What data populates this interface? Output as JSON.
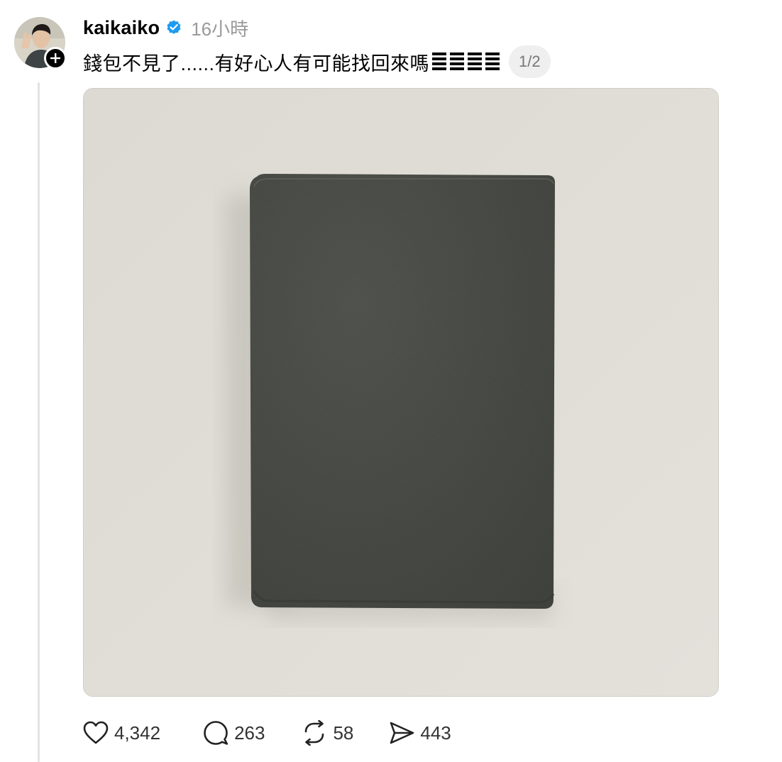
{
  "post": {
    "author": {
      "username": "kaikaiko",
      "verified": true,
      "avatar_icon": "avatar-photo",
      "follow_icon": "plus-icon"
    },
    "timestamp": "16小時",
    "caption": "錢包不見了......有好心人有可能找回來嗎",
    "caption_emoji": "weary-face-emoji",
    "page_indicator": "1/2",
    "image_description_icon": "dark-grey-leather-card-wallet",
    "actions": {
      "likes": "4,342",
      "comments": "263",
      "reposts": "58",
      "shares": "443"
    }
  },
  "colors": {
    "verified_badge": "#1d9bf0",
    "background_beige": "#e0ded7",
    "wallet_grey": "#4c4e49",
    "muted_text": "#9a9a9a"
  }
}
